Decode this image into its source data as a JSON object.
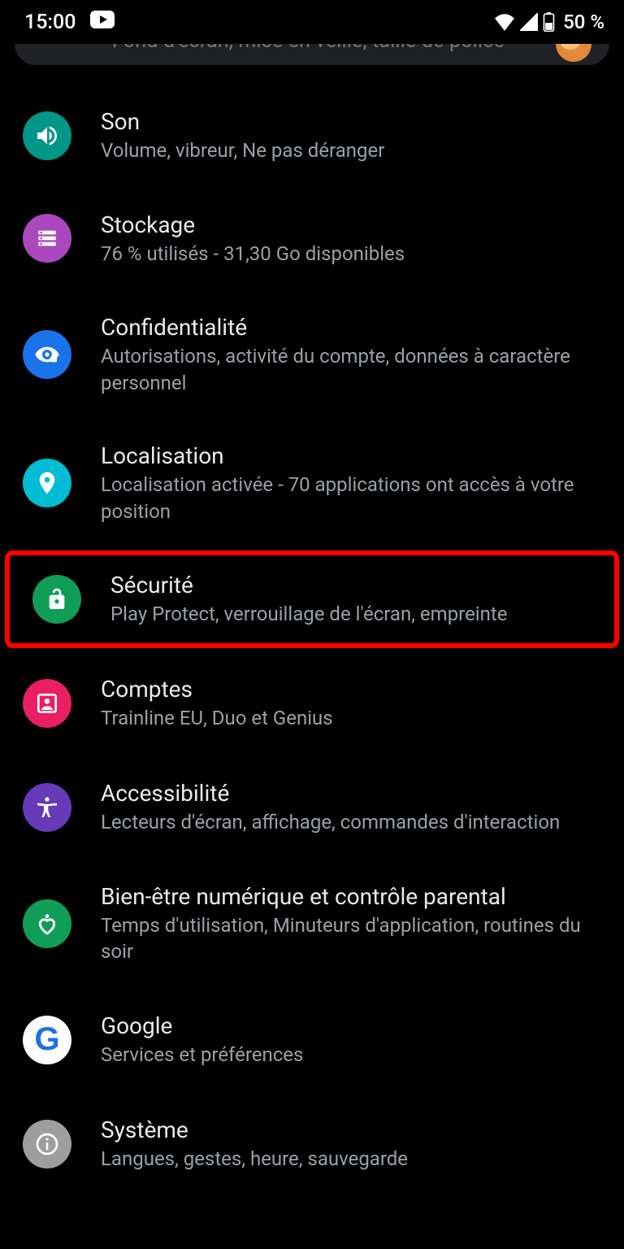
{
  "status": {
    "time": "15:00",
    "battery": "50 %"
  },
  "search_remnant": "Fond d'écran, mise en veille, taille de police",
  "items": [
    {
      "title": "Son",
      "subtitle": "Volume, vibreur, Ne pas déranger"
    },
    {
      "title": "Stockage",
      "subtitle": "76 % utilisés - 31,30 Go disponibles"
    },
    {
      "title": "Confidentialité",
      "subtitle": "Autorisations, activité du compte, données à caractère personnel"
    },
    {
      "title": "Localisation",
      "subtitle": "Localisation activée - 70 applications ont accès à votre position"
    },
    {
      "title": "Sécurité",
      "subtitle": "Play Protect, verrouillage de l'écran, empreinte"
    },
    {
      "title": "Comptes",
      "subtitle": "Trainline EU, Duo et Genius"
    },
    {
      "title": "Accessibilité",
      "subtitle": "Lecteurs d'écran, affichage, commandes d'interaction"
    },
    {
      "title": "Bien-être numérique et contrôle parental",
      "subtitle": "Temps d'utilisation, Minuteurs d'application, routines du soir"
    },
    {
      "title": "Google",
      "subtitle": "Services et préférences"
    },
    {
      "title": "Système",
      "subtitle": "Langues, gestes, heure, sauvegarde"
    }
  ]
}
